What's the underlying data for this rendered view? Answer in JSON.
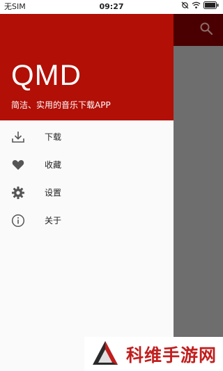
{
  "status_bar": {
    "carrier": "无SIM",
    "time": "09:27"
  },
  "drawer": {
    "app_name": "QMD",
    "tagline": "简洁、实用的音乐下载APP",
    "menu": [
      {
        "label": "下载",
        "icon": "download-icon"
      },
      {
        "label": "收藏",
        "icon": "heart-icon"
      },
      {
        "label": "设置",
        "icon": "gear-icon"
      },
      {
        "label": "关于",
        "icon": "info-icon"
      }
    ]
  },
  "watermark": {
    "text": "科维手游网"
  },
  "colors": {
    "header_red": "#b20f06",
    "appbar_dark": "#4a0000",
    "scrim": "#6e6e6e"
  }
}
